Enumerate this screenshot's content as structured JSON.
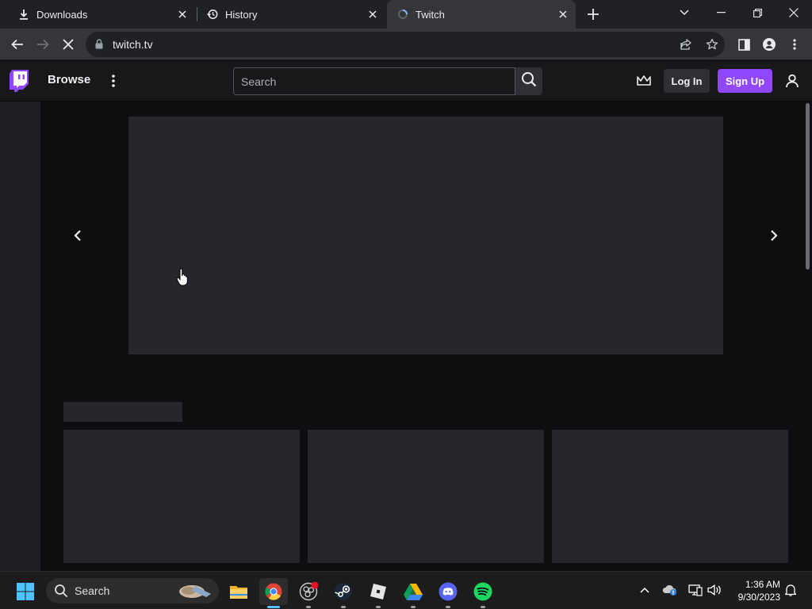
{
  "browser": {
    "tabs": [
      {
        "label": "Downloads",
        "icon": "download-icon"
      },
      {
        "label": "History",
        "icon": "history-icon"
      },
      {
        "label": "Twitch",
        "icon": "loading-icon",
        "active": true
      }
    ],
    "url": "twitch.tv"
  },
  "twitch": {
    "browse_label": "Browse",
    "search_placeholder": "Search",
    "login_label": "Log In",
    "signup_label": "Sign Up",
    "accent_color": "#9147ff"
  },
  "taskbar": {
    "search_label": "Search",
    "apps": [
      "file-explorer-icon",
      "chrome-icon",
      "obs-icon",
      "steam-icon",
      "roblox-icon",
      "google-drive-icon",
      "discord-icon",
      "spotify-icon"
    ],
    "time": "1:36 AM",
    "date": "9/30/2023"
  }
}
